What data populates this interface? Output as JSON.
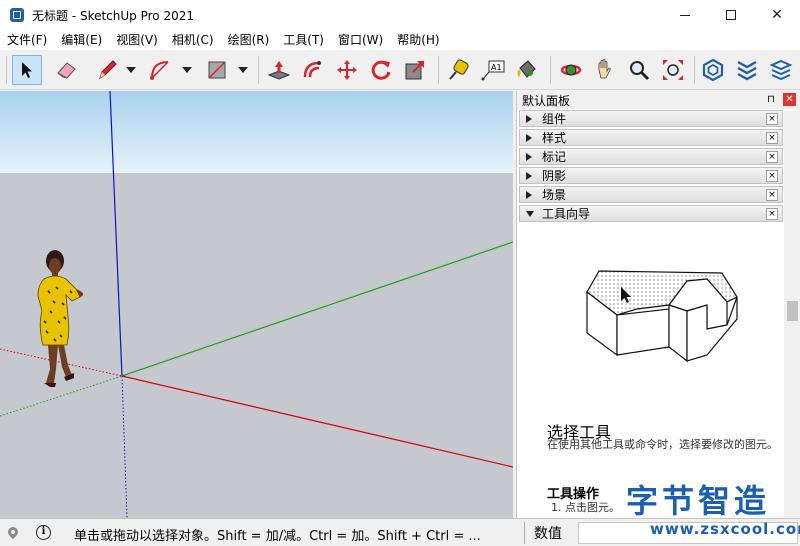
{
  "window": {
    "title": "无标题 - SketchUp Pro 2021",
    "min_label": "",
    "max_label": "",
    "close_label": "✕"
  },
  "menu": {
    "items": [
      "文件(F)",
      "编辑(E)",
      "视图(V)",
      "相机(C)",
      "绘图(R)",
      "工具(T)",
      "窗口(W)",
      "帮助(H)"
    ]
  },
  "toolbar": {
    "tools": [
      {
        "name": "select-tool-icon",
        "active": true
      },
      {
        "name": "eraser-tool-icon"
      },
      {
        "name": "pencil-line-tool-icon"
      },
      {
        "name": "arc-tool-icon"
      },
      {
        "name": "rectangle-tool-icon"
      },
      {
        "name": "push-pull-tool-icon"
      },
      {
        "name": "offset-tool-icon"
      },
      {
        "name": "move-tool-icon"
      },
      {
        "name": "rotate-tool-icon"
      },
      {
        "name": "scale-tool-icon"
      },
      {
        "name": "tape-measure-tool-icon"
      },
      {
        "name": "text-tool-icon",
        "label": "A1"
      },
      {
        "name": "paint-bucket-tool-icon"
      },
      {
        "name": "orbit-tool-icon"
      },
      {
        "name": "pan-tool-icon"
      },
      {
        "name": "zoom-tool-icon"
      },
      {
        "name": "zoom-extents-tool-icon"
      },
      {
        "name": "warehouse-icon"
      },
      {
        "name": "extension-warehouse-icon"
      },
      {
        "name": "layout-icon"
      }
    ],
    "colors": {
      "red": "#d7262c",
      "blue": "#1f5fa8",
      "gray": "#6b6b6b"
    }
  },
  "viewport": {
    "sky_color": "#a9d2ef",
    "ground_color": "#c5c8cf",
    "axis_colors": {
      "x": "#d40000",
      "y": "#1ea01e",
      "z": "#1010c8"
    }
  },
  "tray": {
    "title": "默认面板",
    "pin_label": "⊓",
    "close_label": "✕",
    "panels": [
      {
        "label": "组件",
        "expanded": false
      },
      {
        "label": "样式",
        "expanded": false
      },
      {
        "label": "标记",
        "expanded": false
      },
      {
        "label": "阴影",
        "expanded": false
      },
      {
        "label": "场景",
        "expanded": false
      },
      {
        "label": "工具向导",
        "expanded": true
      }
    ],
    "panel_close_label": "×",
    "guide": {
      "title": "选择工具",
      "description": "在使用其他工具或命令时，选择要修改的图元。",
      "subtitle": "工具操作",
      "step": "1. 点击图元。"
    }
  },
  "status": {
    "info_label": "i",
    "text": "单击或拖动以选择对象。Shift = 加/减。Ctrl = 加。Shift + Ctrl = ...",
    "vcb_label": "数值",
    "vcb_value": ""
  },
  "watermark": {
    "title": "字节智造",
    "url": "www.zsxcool.com"
  }
}
